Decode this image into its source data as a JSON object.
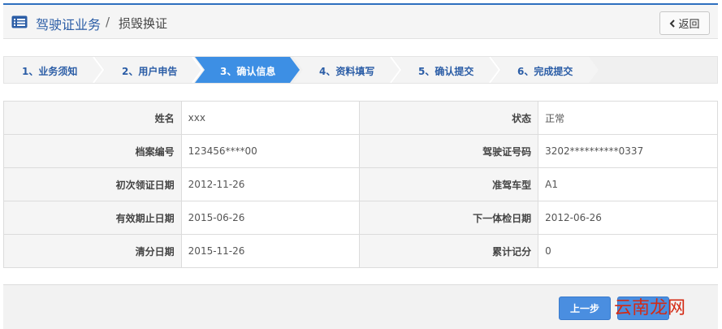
{
  "header": {
    "title": "驾驶证业务",
    "separator": "/",
    "subtitle": "损毁换证",
    "back_label": "返回"
  },
  "steps": [
    {
      "label": "1、业务须知",
      "active": false
    },
    {
      "label": "2、用户申告",
      "active": false
    },
    {
      "label": "3、确认信息",
      "active": true
    },
    {
      "label": "4、资料填写",
      "active": false
    },
    {
      "label": "5、确认提交",
      "active": false
    },
    {
      "label": "6、完成提交",
      "active": false
    }
  ],
  "info_rows": [
    {
      "l1": "姓名",
      "v1": "xxx",
      "l2": "状态",
      "v2": "正常"
    },
    {
      "l1": "档案编号",
      "v1": "123456****00",
      "l2": "驾驶证号码",
      "v2": "3202**********0337"
    },
    {
      "l1": "初次领证日期",
      "v1": "2012-11-26",
      "l2": "准驾车型",
      "v2": "A1"
    },
    {
      "l1": "有效期止日期",
      "v1": "2015-06-26",
      "l2": "下一体检日期",
      "v2": "2012-06-26"
    },
    {
      "l1": "清分日期",
      "v1": "2015-11-26",
      "l2": "累计记分",
      "v2": "0"
    }
  ],
  "footer": {
    "prev_label": "上一步",
    "watermark": "云南龙网"
  },
  "colors": {
    "accent": "#2e6fbf",
    "active_step": "#3d8fe4",
    "button": "#4a8ee0",
    "watermark": "#d42a14"
  }
}
